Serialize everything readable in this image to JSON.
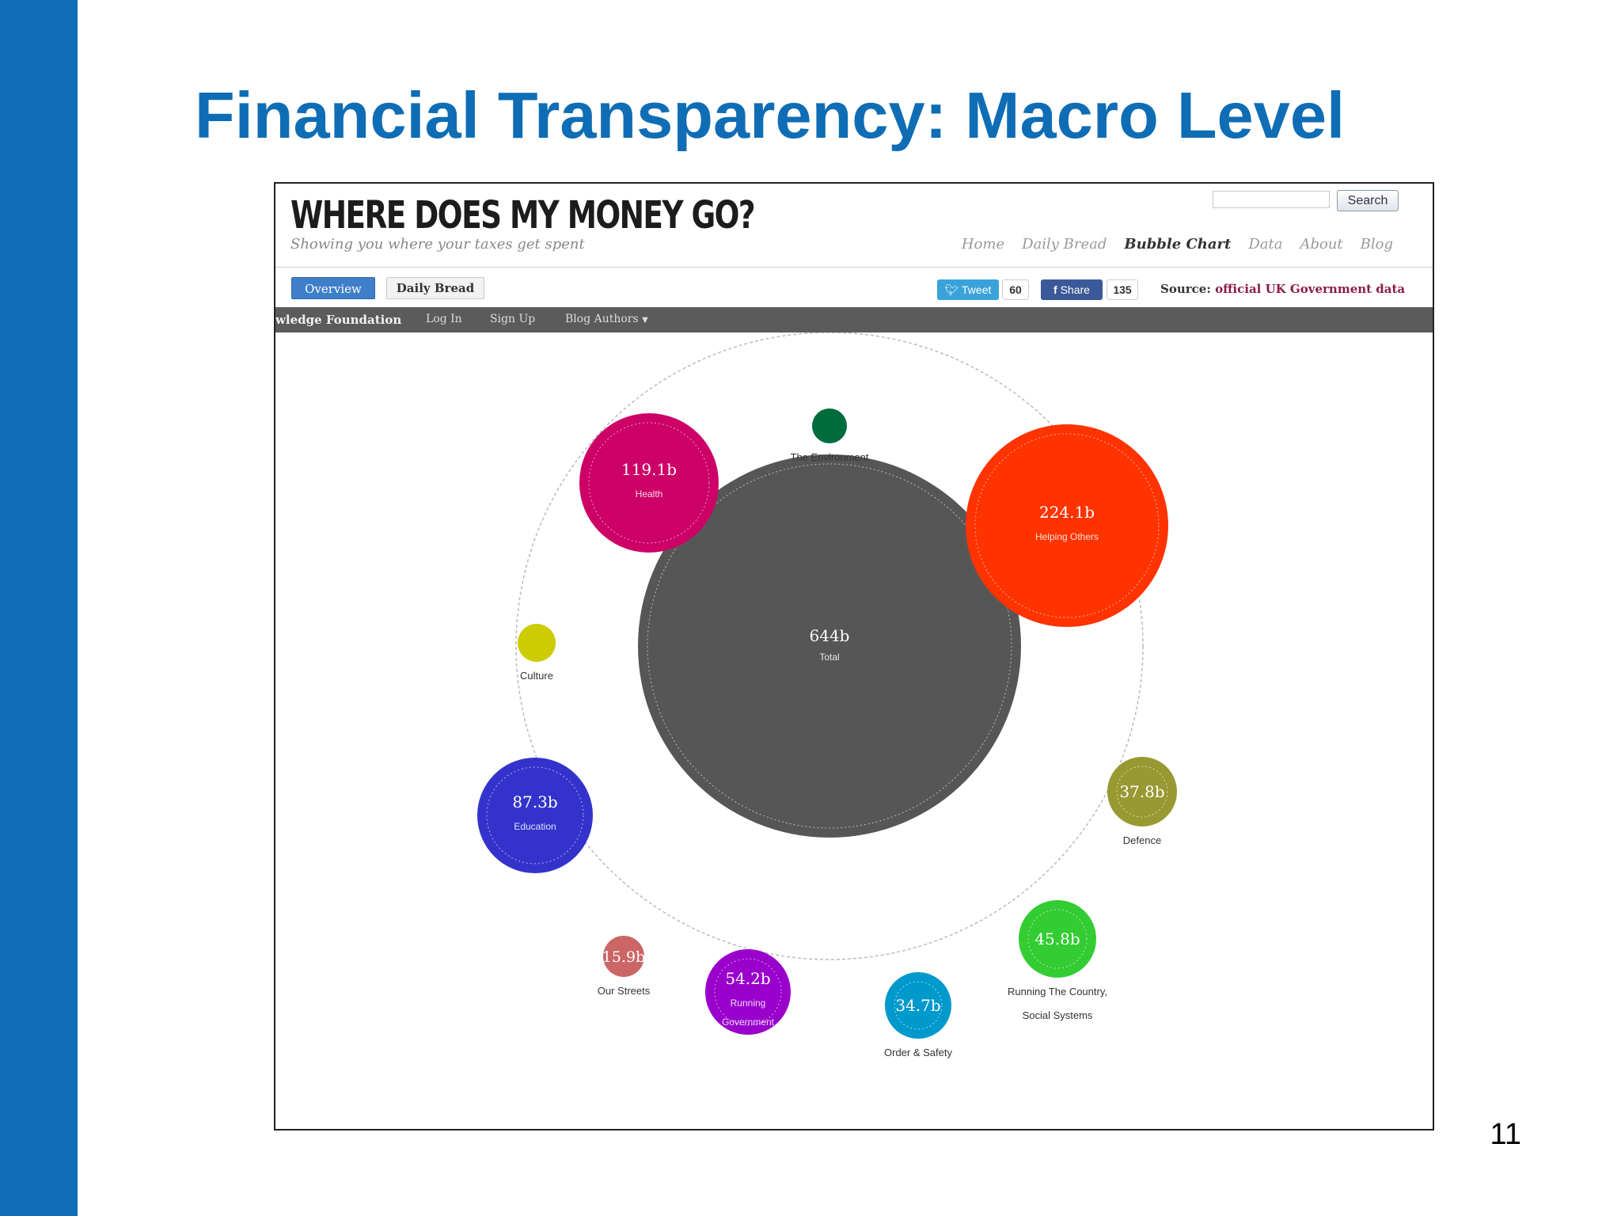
{
  "slide": {
    "title": "Financial Transparency: Macro Level",
    "page_number": "11",
    "accent_color": "#0f6db5"
  },
  "site": {
    "title": "WHERE DOES MY MONEY GO?",
    "tagline": "Showing you where your taxes get spent",
    "search_button": "Search",
    "nav": [
      {
        "label": "Home",
        "active": false
      },
      {
        "label": "Daily Bread",
        "active": false
      },
      {
        "label": "Bubble Chart",
        "active": true
      },
      {
        "label": "Data",
        "active": false
      },
      {
        "label": "About",
        "active": false
      },
      {
        "label": "Blog",
        "active": false
      }
    ],
    "toolbar": {
      "overview": "Overview",
      "daily_bread": "Daily Bread",
      "tweet": "Tweet",
      "tweet_count": "60",
      "share": "Share",
      "share_count": "135",
      "source_prefix": "Source:",
      "source_link": "official UK Government data"
    },
    "dark_bar": {
      "org": "wledge Foundation",
      "login": "Log In",
      "signup": "Sign Up",
      "blog_authors": "Blog Authors"
    }
  },
  "chart_data": {
    "type": "bubble",
    "center": {
      "label": "Total",
      "value": "644b",
      "value_num": 644,
      "color": "#575657"
    },
    "series": [
      {
        "label": "The Environment",
        "value": "",
        "color": "#006b3c"
      },
      {
        "label": "Helping Others",
        "value": "224.1b",
        "value_num": 224.1,
        "color": "#ff3300"
      },
      {
        "label": "Defence",
        "value": "37.8b",
        "value_num": 37.8,
        "color": "#999933"
      },
      {
        "label": "Running The Country, Social Systems",
        "label_lines": [
          "Running The Country,",
          "Social Systems"
        ],
        "value": "45.8b",
        "value_num": 45.8,
        "color": "#33cc33"
      },
      {
        "label": "Order & Safety",
        "value": "34.7b",
        "value_num": 34.7,
        "color": "#0099cc"
      },
      {
        "label": "Running Government",
        "label_lines": [
          "Running",
          "Government"
        ],
        "value": "54.2b",
        "value_num": 54.2,
        "color": "#9900cc"
      },
      {
        "label": "Our Streets",
        "value": "15.9b",
        "value_num": 15.9,
        "color": "#cc6666"
      },
      {
        "label": "Education",
        "value": "87.3b",
        "value_num": 87.3,
        "color": "#3333cc"
      },
      {
        "label": "Culture",
        "value": "",
        "color": "#cccc00"
      },
      {
        "label": "Health",
        "value": "119.1b",
        "value_num": 119.1,
        "color": "#cc0066"
      }
    ]
  }
}
